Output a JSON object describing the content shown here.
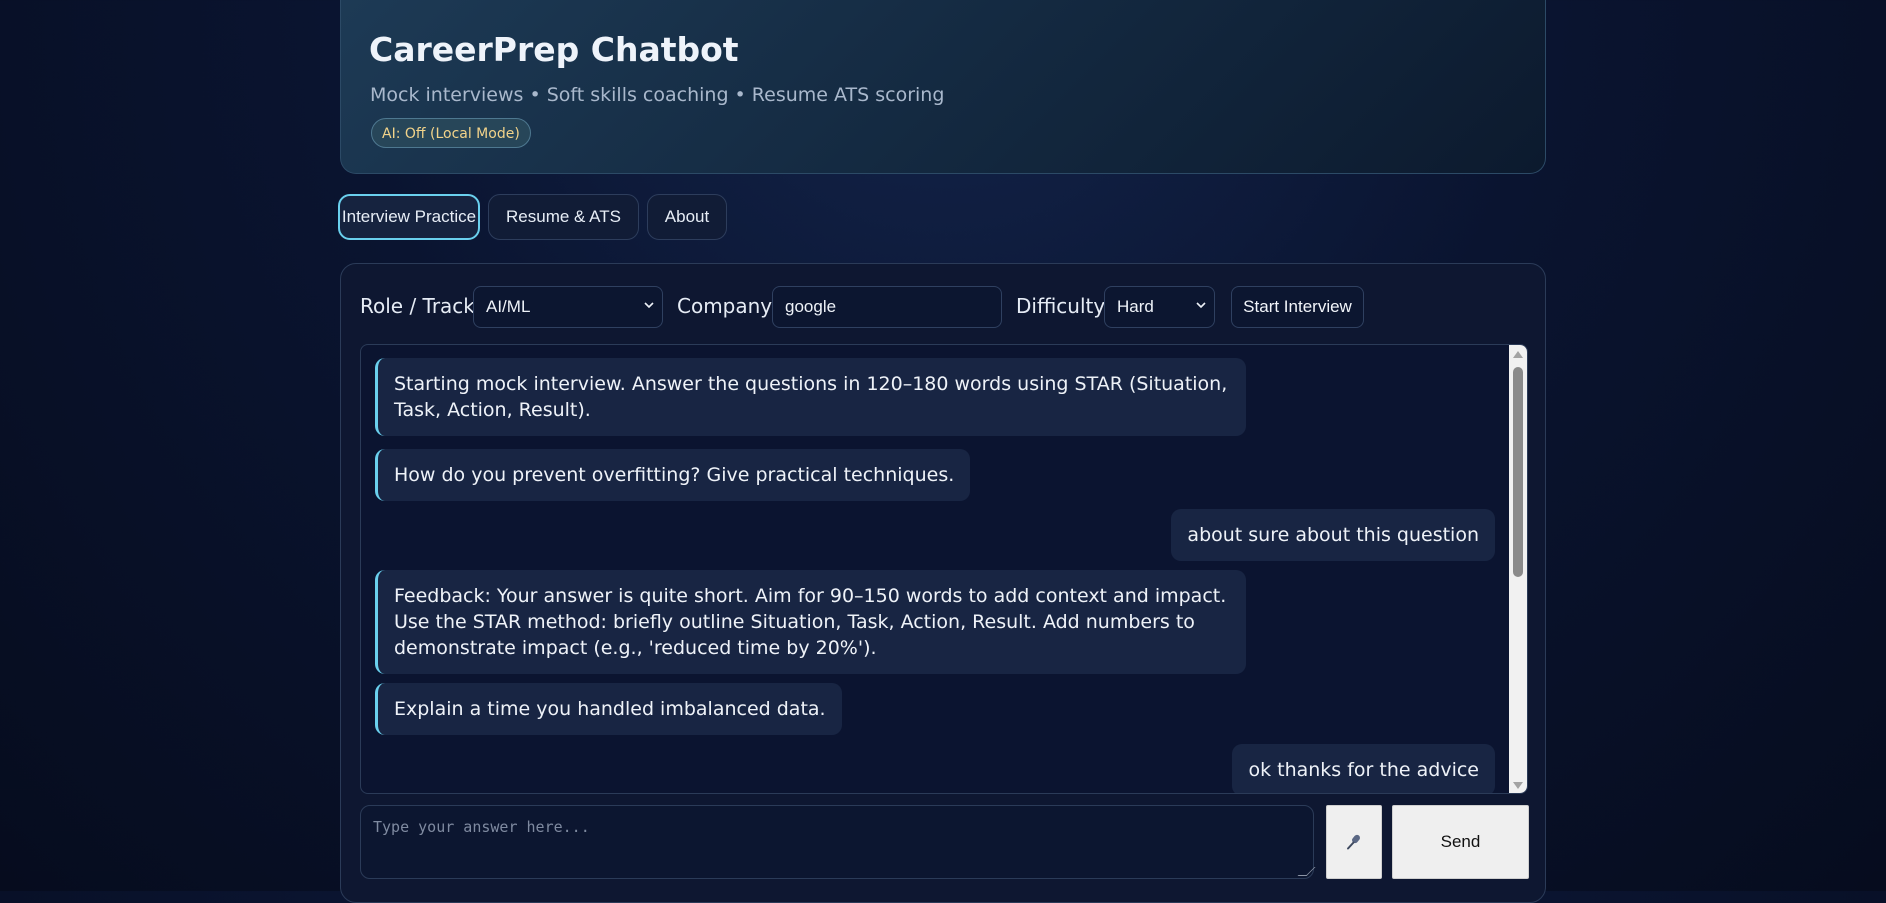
{
  "header": {
    "title": "CareerPrep Chatbot",
    "subtitle": "Mock interviews • Soft skills coaching • Resume ATS scoring",
    "ai_badge": "AI: Off (Local Mode)"
  },
  "tabs": [
    {
      "label": "Interview Practice",
      "active": true
    },
    {
      "label": "Resume & ATS",
      "active": false
    },
    {
      "label": "About",
      "active": false
    }
  ],
  "controls": {
    "role_label": "Role / Track:",
    "role_value": "AI/ML",
    "company_label": "Company:",
    "company_value": "google",
    "difficulty_label": "Difficulty:",
    "difficulty_value": "Hard",
    "start_button": "Start Interview"
  },
  "messages": [
    {
      "sender": "bot",
      "text": "Starting mock interview. Answer the questions in 120–180 words using STAR (Situation, Task, Action, Result)."
    },
    {
      "sender": "bot",
      "text": "How do you prevent overfitting? Give practical techniques."
    },
    {
      "sender": "user",
      "text": "about sure about this question"
    },
    {
      "sender": "bot",
      "text": "Feedback: Your answer is quite short. Aim for 90–150 words to add context and impact. Use the STAR method: briefly outline Situation, Task, Action, Result. Add numbers to demonstrate impact (e.g., 'reduced time by 20%')."
    },
    {
      "sender": "bot",
      "text": "Explain a time you handled imbalanced data."
    },
    {
      "sender": "user",
      "text": "ok thanks for the advice"
    }
  ],
  "composer": {
    "placeholder": "Type your answer here...",
    "mic_icon": "microphone-icon",
    "send_label": "Send"
  },
  "colors": {
    "accent": "#6ad0ee",
    "badge_text": "#f2d38a",
    "bubble": "#182543"
  }
}
